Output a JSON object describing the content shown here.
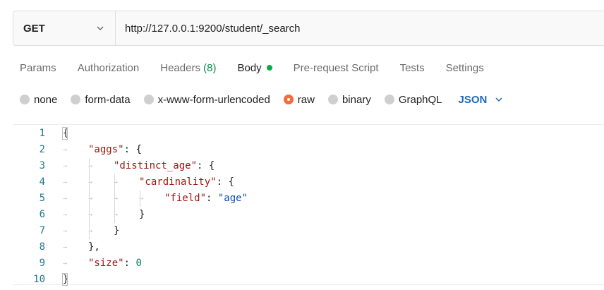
{
  "request": {
    "method": "GET",
    "url": "http://127.0.0.1:9200/student/_search"
  },
  "tabs": [
    {
      "label": "Params"
    },
    {
      "label": "Authorization"
    },
    {
      "label": "Headers",
      "count": "(8)"
    },
    {
      "label": "Body",
      "active": true
    },
    {
      "label": "Pre-request Script"
    },
    {
      "label": "Tests"
    },
    {
      "label": "Settings"
    }
  ],
  "body_types": [
    {
      "label": "none"
    },
    {
      "label": "form-data"
    },
    {
      "label": "x-www-form-urlencoded"
    },
    {
      "label": "raw",
      "selected": true
    },
    {
      "label": "binary"
    },
    {
      "label": "GraphQL"
    }
  ],
  "language": "JSON",
  "editor": {
    "lines": [
      {
        "n": "1",
        "indent": 0,
        "tokens": [
          [
            "p",
            "{"
          ]
        ]
      },
      {
        "n": "2",
        "indent": 1,
        "tokens": [
          [
            "k",
            "\"aggs\""
          ],
          [
            "p",
            ": "
          ],
          [
            "p",
            "{"
          ]
        ]
      },
      {
        "n": "3",
        "indent": 2,
        "tokens": [
          [
            "k",
            "\"distinct_age\""
          ],
          [
            "p",
            ": "
          ],
          [
            "p",
            "{"
          ]
        ]
      },
      {
        "n": "4",
        "indent": 3,
        "tokens": [
          [
            "k",
            "\"cardinality\""
          ],
          [
            "p",
            ": "
          ],
          [
            "p",
            "{"
          ]
        ]
      },
      {
        "n": "5",
        "indent": 4,
        "tokens": [
          [
            "k",
            "\"field\""
          ],
          [
            "p",
            ": "
          ],
          [
            "s",
            "\"age\""
          ]
        ]
      },
      {
        "n": "6",
        "indent": 3,
        "tokens": [
          [
            "p",
            "}"
          ]
        ]
      },
      {
        "n": "7",
        "indent": 2,
        "tokens": [
          [
            "p",
            "}"
          ]
        ]
      },
      {
        "n": "8",
        "indent": 1,
        "tokens": [
          [
            "p",
            "},"
          ]
        ]
      },
      {
        "n": "9",
        "indent": 1,
        "tokens": [
          [
            "k",
            "\"size\""
          ],
          [
            "p",
            ": "
          ],
          [
            "n",
            "0"
          ]
        ]
      },
      {
        "n": "10",
        "indent": 0,
        "tokens": [
          [
            "p",
            "}"
          ]
        ]
      }
    ]
  },
  "colors": {
    "accent": "#f26b3a",
    "language": "#1f66c1",
    "headers_count": "#0f8a4a",
    "body_dot": "#0caa4b",
    "json_key": "#a31515",
    "json_string": "#0451a5",
    "json_number": "#098658",
    "line_number": "#237893"
  },
  "icons": {
    "method_dropdown": "chevron-down-icon",
    "language_dropdown": "chevron-down-icon"
  }
}
